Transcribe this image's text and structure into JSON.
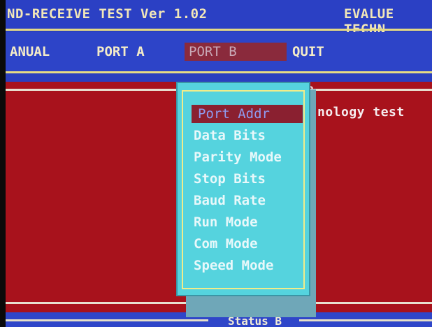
{
  "titlebar": {
    "left_text": "ND-RECEIVE TEST Ver 1.02",
    "right_text": "EVALUE TECHN"
  },
  "menubar": {
    "items": [
      {
        "label": "ANUAL"
      },
      {
        "label": "PORT A"
      },
      {
        "label": "PORT B",
        "selected": true
      },
      {
        "label": "QUIT"
      }
    ]
  },
  "workarea": {
    "panel_title_fragment": "B",
    "panel_text": "nology test"
  },
  "dropdown": {
    "items": [
      {
        "label": "Port Addr",
        "selected": true
      },
      {
        "label": "Data Bits"
      },
      {
        "label": "Parity Mode"
      },
      {
        "label": "Stop Bits"
      },
      {
        "label": "Baud Rate"
      },
      {
        "label": "Run Mode"
      },
      {
        "label": "Com Mode"
      },
      {
        "label": "Speed Mode"
      }
    ]
  },
  "statusbar": {
    "title": "Status B"
  },
  "colors": {
    "title_bg": "#2b40c4",
    "work_bg": "#a8121c",
    "menu_bg": "#55d3de",
    "highlight_bg": "#8a2030",
    "accent_line": "#e6db84"
  }
}
